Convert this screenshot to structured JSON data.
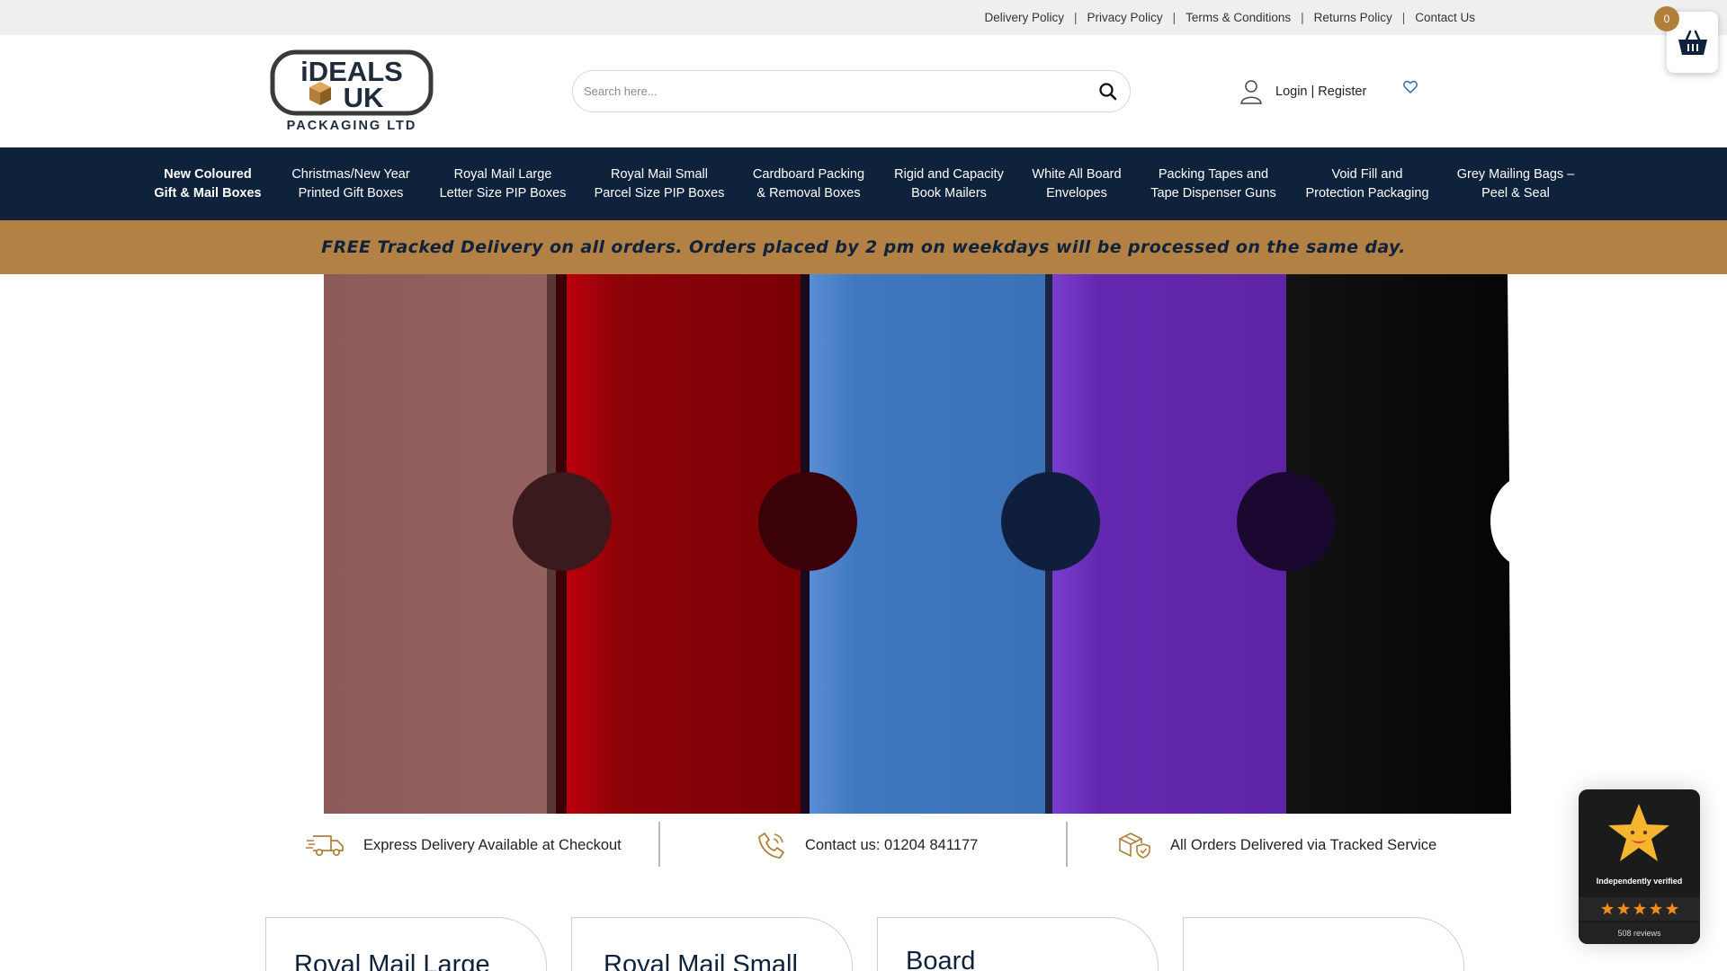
{
  "top_links": [
    "Delivery Policy",
    "Privacy Policy",
    "Terms & Conditions",
    "Returns Policy",
    "Contact Us"
  ],
  "logo": {
    "text_line1": "iDEALS",
    "text_line2": "UK",
    "text_line3": "PACKAGING LTD"
  },
  "search": {
    "placeholder": "Search here..."
  },
  "account": {
    "label": "Login | Register"
  },
  "cart": {
    "count": "0"
  },
  "nav": [
    "New Coloured\nGift & Mail Boxes",
    "Christmas/New Year\nPrinted Gift Boxes",
    "Royal Mail Large\nLetter Size PIP Boxes",
    "Royal Mail Small\nParcel Size PIP Boxes",
    "Cardboard Packing\n& Removal Boxes",
    "Rigid and Capacity\nBook Mailers",
    "White All Board\nEnvelopes",
    "Packing Tapes and\nTape Dispenser Guns",
    "Void Fill and\nProtection Packaging",
    "Grey Mailing Bags –\nPeel & Seal"
  ],
  "promo": "FREE Tracked Delivery on all orders. Orders placed by 2 pm on weekdays will be processed on the same day.",
  "features": [
    {
      "icon": "delivery-truck-icon",
      "text": "Express Delivery Available at Checkout"
    },
    {
      "icon": "phone-icon",
      "text": "Contact us: 01204 841177"
    },
    {
      "icon": "tracked-parcel-icon",
      "text": "All Orders Delivered via Tracked Service"
    }
  ],
  "cards": [
    "Royal Mail Large",
    "Royal Mail Small",
    "Board",
    ""
  ],
  "reviews_badge": {
    "verified": "Independently verified",
    "reviews": "508 reviews"
  },
  "colors": {
    "nav_bg": "#0f223c",
    "promo_bg": "#b38143",
    "accent": "#b07f3a",
    "topbar_bg": "#efefef"
  }
}
